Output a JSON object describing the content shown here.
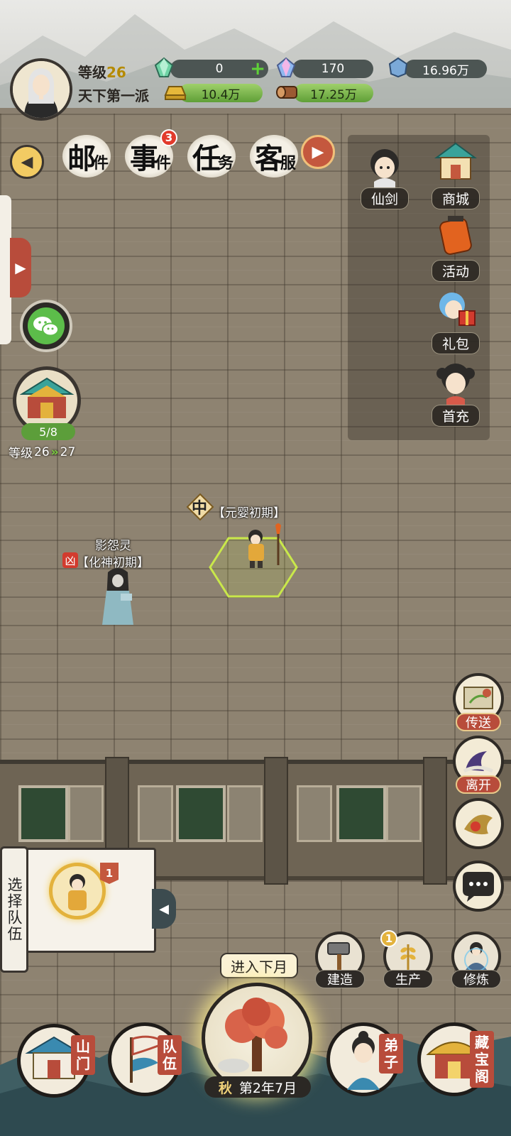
{
  "player": {
    "level_label": "等级",
    "level_value": "26",
    "sect_name": "天下第一派"
  },
  "resources": {
    "gem_green": "0",
    "gem_rainbow": "170",
    "crystal_blue": "16.96万",
    "gold": "10.4万",
    "wood": "17.25万"
  },
  "top_nav": {
    "mail": {
      "big": "邮",
      "small": "件"
    },
    "events": {
      "big": "事",
      "small": "件",
      "badge": "3"
    },
    "tasks": {
      "big": "任",
      "small": "务"
    },
    "service": {
      "big": "客",
      "small": "服"
    }
  },
  "side_menu": [
    {
      "label": "仙剑"
    },
    {
      "label": "商城"
    },
    {
      "label": "活动"
    },
    {
      "label": "礼包"
    },
    {
      "label": "首充"
    }
  ],
  "sect": {
    "progress": "5/8",
    "level_label": "等级",
    "level_from": "26",
    "level_to": "27"
  },
  "characters": {
    "player": {
      "icon_char": "中",
      "realm": "【元婴初期】"
    },
    "enemy": {
      "name": "影怨灵",
      "icon_char": "凶",
      "realm": "【化神初期】"
    }
  },
  "actions": {
    "teleport": "传送",
    "leave": "离开"
  },
  "team": {
    "title": "选择队伍",
    "badge": "1"
  },
  "production": {
    "build": "建造",
    "produce": "生产",
    "produce_badge": "1",
    "cultivate": "修炼"
  },
  "bottom_nav": {
    "gate": "山门",
    "team": "队伍",
    "disciple": "弟子",
    "treasury": "藏宝阁",
    "next_month": "进入下月",
    "season": "秋",
    "date": "第2年7月"
  },
  "colors": {
    "accent_red": "#b84c3b",
    "progress_green": "#5c9e3a",
    "dark": "#2e2a26",
    "gold_text": "#f0d27a"
  }
}
